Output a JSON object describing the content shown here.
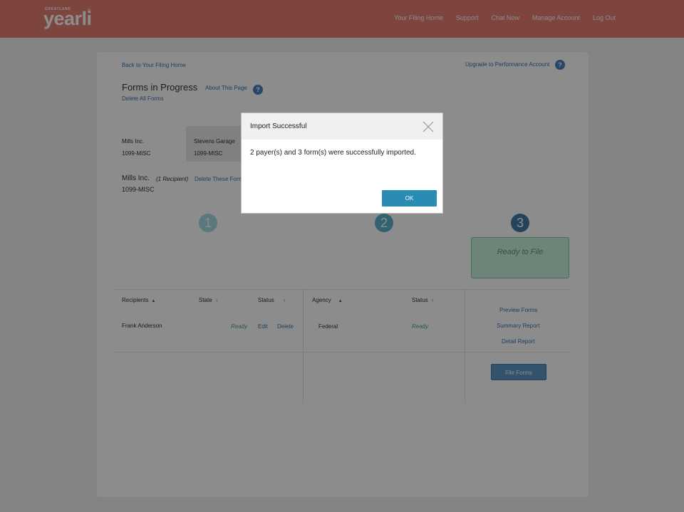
{
  "brand": {
    "tagline": "GREATLAND",
    "name": "yearli",
    "mark": "®"
  },
  "nav": [
    "Your Filing Home",
    "Support",
    "Chat Now",
    "Manage Account",
    "Log Out"
  ],
  "page": {
    "back_link": "Back to Your Filing Home",
    "upgrade_link": "Upgrade to Performance Account",
    "help_glyph": "?",
    "title": "Forms in Progress",
    "about_link": "About This Page",
    "delete_all": "Delete All Forms"
  },
  "payers": [
    {
      "name": "Mills Inc.",
      "form": "1099-MISC"
    },
    {
      "name": "Stevens Garage",
      "form": "1099-MISC"
    }
  ],
  "selected_payer": {
    "name": "Mills Inc.",
    "count": "(1 Recipient)",
    "delete_link": "Delete These Forms",
    "form": "1099-MISC"
  },
  "steps": {
    "one": "1",
    "two": "2",
    "three": "3",
    "ready": "Ready to File",
    "colors": {
      "step1": "#a7dbe6",
      "step2": "#5bb3cf",
      "step3": "#3e7aa6"
    }
  },
  "recipients_table": {
    "headers": {
      "recipients": "Recipients",
      "state": "State",
      "status": "Status"
    },
    "rows": [
      {
        "name": "Frank Anderson",
        "status": "Ready",
        "edit": "Edit",
        "delete": "Delete"
      }
    ]
  },
  "agency_table": {
    "headers": {
      "agency": "Agency",
      "status": "Status"
    },
    "rows": [
      {
        "agency": "Federal",
        "status": "Ready"
      }
    ]
  },
  "actions": {
    "preview": "Preview Forms",
    "summary": "Summary Report",
    "detail": "Detail Report",
    "file": "File Forms"
  },
  "modal": {
    "title": "Import Successful",
    "message": "2 payer(s) and 3 form(s) were successfully imported.",
    "ok": "OK",
    "close_icon": "close-icon"
  }
}
